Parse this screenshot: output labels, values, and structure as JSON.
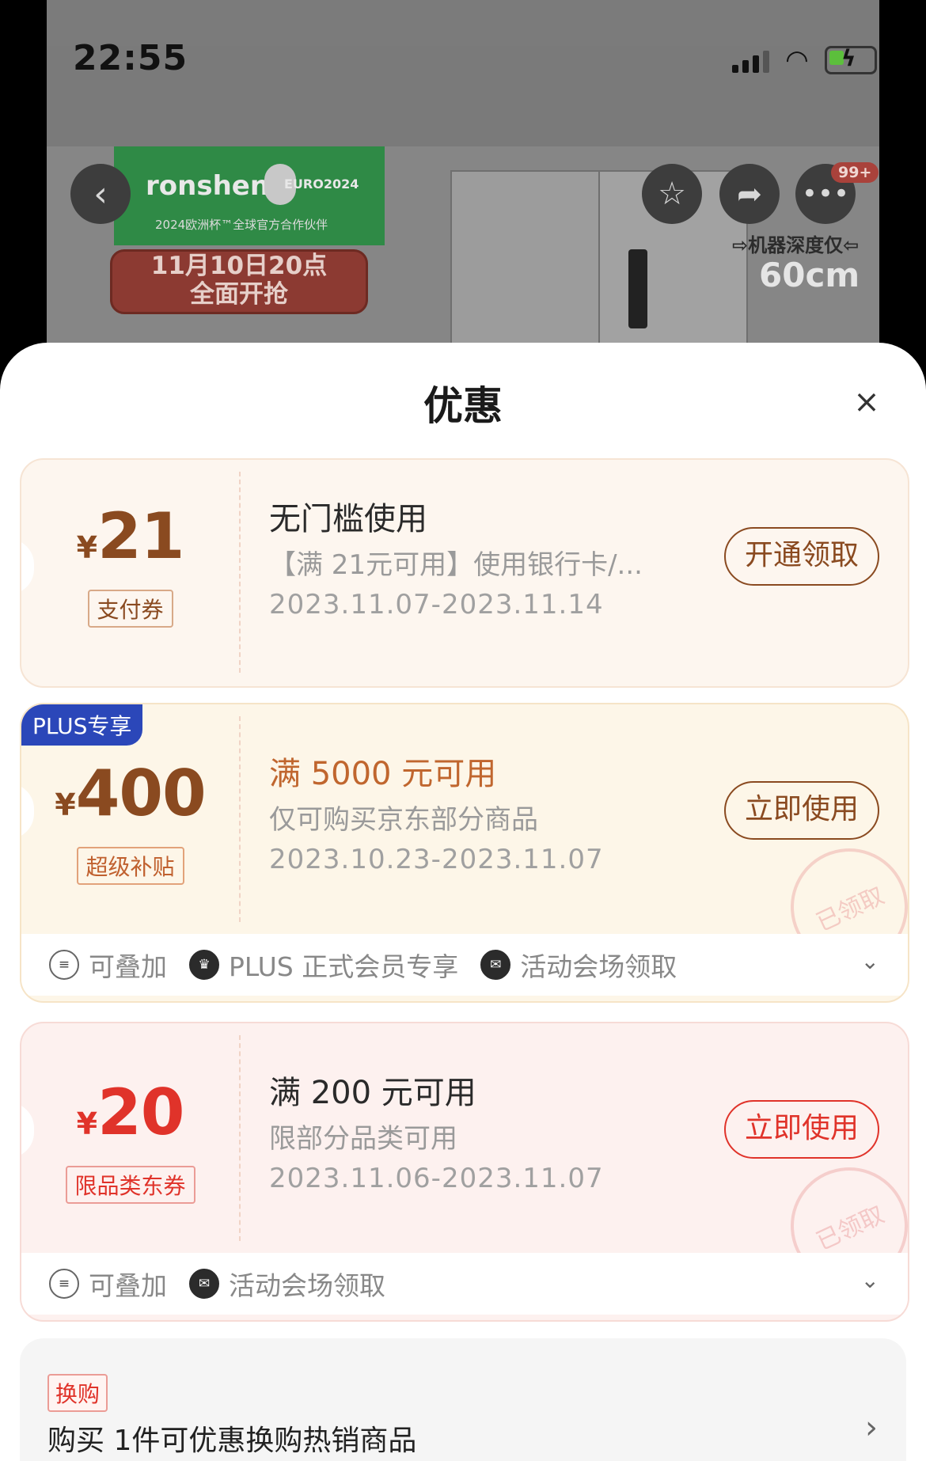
{
  "status_bar": {
    "time": "22:55"
  },
  "background_page": {
    "brand_name": "ronshen",
    "brand_euro": "EURO2024",
    "brand_sub": "2024欧洲杯™全球官方合作伙伴",
    "promo_line1": "11月10日20点",
    "promo_line2": "全面开抢",
    "message_badge": "99+",
    "depth_label": "⇨机器深度仅⇦",
    "depth_value": "60cm"
  },
  "sheet": {
    "title": "优惠",
    "close_icon": "×"
  },
  "coupons": [
    {
      "currency": "¥",
      "amount": "21",
      "type_tag": "支付券",
      "title": "无门槛使用",
      "desc": "【满 21元可用】使用银行卡/...",
      "date_range": "2023.11.07-2023.11.14",
      "action": "开通领取"
    },
    {
      "badge": "PLUS专享",
      "currency": "¥",
      "amount": "400",
      "type_tag": "超级补贴",
      "title": "满 5000 元可用",
      "desc": "仅可购买京东部分商品",
      "date_range": "2023.10.23-2023.11.07",
      "action": "立即使用",
      "stamp": "已领取",
      "tags": [
        "可叠加",
        "PLUS 正式会员专享",
        "活动会场领取"
      ]
    },
    {
      "currency": "¥",
      "amount": "20",
      "type_tag": "限品类东券",
      "title": "满 200 元可用",
      "desc": "限部分品类可用",
      "date_range": "2023.11.06-2023.11.07",
      "action": "立即使用",
      "stamp": "已领取",
      "tags": [
        "可叠加",
        "活动会场领取"
      ]
    }
  ],
  "exchange": {
    "tag": "换购",
    "text": "购买 1件可优惠换购热销商品"
  },
  "colors": {
    "gold_accent": "#8a4a20",
    "red_accent": "#e0332a",
    "plus_blue": "#2b47b9"
  }
}
